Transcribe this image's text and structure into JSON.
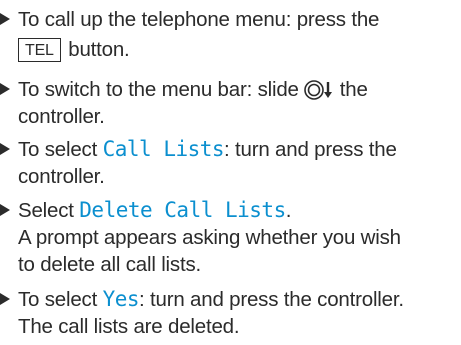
{
  "steps": [
    {
      "lines": [
        "To call up the telephone menu: press the",
        "button."
      ],
      "key_label": "TEL"
    },
    {
      "lines": [
        "To switch to the menu bar: slide",
        "the",
        "controller."
      ],
      "icon": "controller-slide-down-icon"
    },
    {
      "lines": [
        "To select",
        "Call Lists",
        ": turn and press the",
        "controller."
      ]
    },
    {
      "lines": [
        "Select",
        "Delete Call Lists",
        ".",
        "A prompt appears asking whether you wish",
        "to delete all call lists."
      ]
    },
    {
      "lines": [
        "To select",
        "Yes",
        ": turn and press the controller.",
        "The call lists are deleted."
      ]
    }
  ],
  "colors": {
    "accent": "#0b8fcf",
    "text": "#2b2b2b"
  }
}
